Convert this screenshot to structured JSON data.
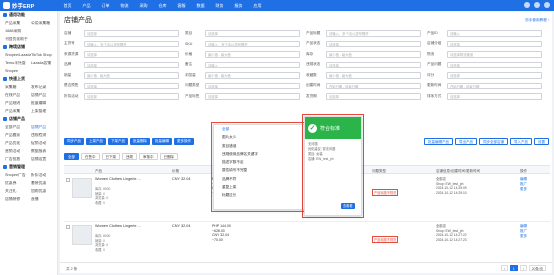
{
  "app": {
    "title": "妙手ERP"
  },
  "topnav": [
    "首页",
    "产品",
    "订单",
    "物流",
    "采购",
    "仓库",
    "客服",
    "数据",
    "财务",
    "服务",
    "应用"
  ],
  "sidebar": [
    {
      "group": "通用功能",
      "rows": [
        [
          "产品采集",
          "公用采集箱"
        ],
        [
          "1688采购",
          ""
        ],
        [
          "刊登优化助手",
          ""
        ]
      ]
    },
    {
      "group": "跨境店铺",
      "rows": [
        [
          "Shopee/Lazada",
          "TikTok Shop"
        ],
        [
          "Temu半托管",
          "Lazada店铺"
        ],
        [
          "Shopee",
          ""
        ]
      ]
    },
    {
      "group": "快速上货",
      "rows": [
        [
          "采集箱",
          "发布记录"
        ],
        [
          "在线产品",
          "店铺产品"
        ],
        [
          "产品规则",
          "批量编辑"
        ],
        [
          "产品采集",
          "上架管理"
        ]
      ]
    },
    {
      "group": "店铺产品",
      "rows": [
        [
          "全部产品",
          "店铺产品"
        ],
        [
          "产品搬家",
          "违规检测"
        ],
        [
          "产品优化",
          "促销活动"
        ],
        [
          "营销活动",
          "数据报表"
        ],
        [
          "广告投放",
          "店铺设置"
        ]
      ]
    },
    {
      "group": "营销管理",
      "rows": [
        [
          "Shopee广告",
          "折扣活动"
        ],
        [
          "优惠券",
          "套装优惠"
        ],
        [
          "关注礼",
          "加购优惠"
        ],
        [
          "店铺装修",
          "直播"
        ]
      ]
    }
  ],
  "page": {
    "title": "店铺产品",
    "help": "妙手使用教程 ›"
  },
  "filters": [
    [
      {
        "label": "店铺",
        "placeholder": "请选择"
      },
      {
        "label": "类目",
        "placeholder": "请选择"
      },
      {
        "label": "产品标题",
        "placeholder": "请输入，多个请以逗号隔开"
      },
      {
        "label": "产品ID",
        "placeholder": "请输入"
      }
    ],
    [
      {
        "label": "主货号",
        "placeholder": "请输入，多个请以逗号隔开"
      },
      {
        "label": "SKU",
        "placeholder": "请输入，多个请以逗号隔开"
      },
      {
        "label": "产品状态",
        "placeholder": "请选择"
      },
      {
        "label": "店铺分组",
        "placeholder": "请选择"
      }
    ],
    [
      {
        "label": "来源货源",
        "placeholder": "请选择"
      },
      {
        "label": "价格",
        "placeholder": "最小值 - 最大值"
      },
      {
        "label": "库存",
        "placeholder": "最小值 - 最大值"
      },
      {
        "label": "物流",
        "placeholder": "请选择物流渠道"
      }
    ],
    [
      {
        "label": "品牌",
        "placeholder": "请选择"
      },
      {
        "label": "备注",
        "placeholder": "请输入"
      },
      {
        "label": "违规状态",
        "placeholder": "请选择"
      },
      {
        "label": "产品问题",
        "placeholder": "请选择"
      }
    ],
    [
      {
        "label": "销量",
        "placeholder": "最小值 - 最大值"
      },
      {
        "label": "浏览量",
        "placeholder": "最小值 - 最大值"
      },
      {
        "label": "收藏数",
        "placeholder": "最小值 - 最大值"
      },
      {
        "label": "评分",
        "placeholder": "请选择"
      }
    ],
    [
      {
        "label": "是否预售",
        "placeholder": "请选择"
      },
      {
        "label": "问题类型",
        "placeholder": "请选择"
      },
      {
        "label": "创建时间",
        "placeholder": "开始日期 - 结束日期"
      },
      {
        "label": "更新时间",
        "placeholder": "开始日期 - 结束日期"
      }
    ],
    [
      {
        "label": "折扣活动",
        "placeholder": "请选择"
      },
      {
        "label": "产品标签",
        "placeholder": "请选择"
      },
      {
        "label": "发货期",
        "placeholder": "请选择"
      },
      {
        "label": "排序方式",
        "placeholder": "请选择"
      }
    ]
  ],
  "actions": {
    "left": [
      "同步产品",
      "上架产品",
      "下架产品",
      "批量删除",
      "批量编辑",
      "更多操作"
    ],
    "right": [
      "批量编辑产品",
      "导出产品",
      "同步全部店铺",
      "导入产品",
      "设置"
    ]
  },
  "tabs": [
    "全部",
    "在售中",
    "已下架",
    "违规",
    "审核中",
    "已删除"
  ],
  "columns": [
    "产品",
    "价格",
    "库存/销量",
    "问题类型",
    "店铺信息/创建时间/更新时间",
    "操作"
  ],
  "rows": [
    {
      "name": "Women Clothes Lingerie ...",
      "attrs": [
        "库存: 8000",
        "销量: 0",
        "浏览量: 0",
        "收藏: 0"
      ],
      "price": "CNY 32.04",
      "price2": [
        "PHP 144.00",
        "~628.00",
        "CNY 32.04",
        "~70.00"
      ],
      "flag": "产品标题不规范",
      "shop": [
        "全部店",
        "Shop: EW_test_ph",
        "2024-10-12 14:29:09",
        "2024-10-12 14:29:10"
      ],
      "ops": [
        "编辑",
        "推广",
        "更多"
      ]
    },
    {
      "name": "Women Clothes Lingerie ...",
      "attrs": [
        "库存: 8000",
        "销量: 0",
        "浏览量: 0",
        "收藏: 0"
      ],
      "price": "CNY 32.04",
      "price2": [
        "PHP 144.00",
        "~628.00",
        "CNY 32.04",
        "~70.00"
      ],
      "flag": "产品标题不规范",
      "shop": [
        "全部店",
        "Shop: EW_test_ph",
        "2024-10-12 14:27:22",
        "2024-10-12 14:27:23"
      ],
      "ops": [
        "编辑",
        "推广",
        "更多"
      ]
    }
  ],
  "dropdown": {
    "items": [
      "全部",
      "图片太少",
      "类目错误",
      "违规使用品牌名关键字",
      "描述字数不足",
      "属性填写不完整",
      "品牌不符",
      "重复上架",
      "标题过长"
    ],
    "selected": 0
  },
  "panel": {
    "title": "符合标准",
    "lines": [
      "无问题",
      "优化建议: 暂无问题",
      "类目: 女装",
      "店铺: EW_test_ph"
    ],
    "button": "去看看"
  },
  "footer": {
    "count": "共 2 条",
    "pager": [
      "‹",
      "1",
      "›",
      "20条/页"
    ]
  },
  "colors": {
    "primary": "#1f6fe5",
    "alert": "#e64b3c",
    "success": "#2bb44a"
  }
}
